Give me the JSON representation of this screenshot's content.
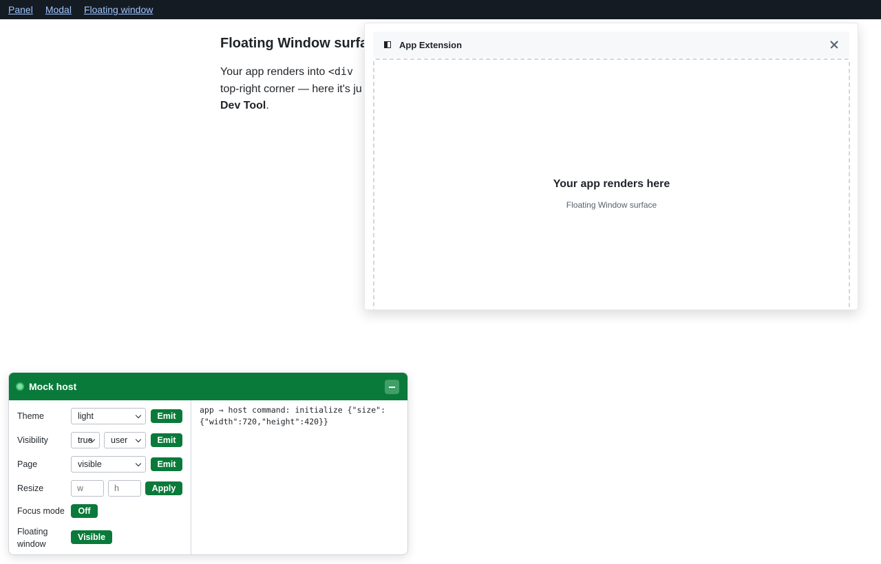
{
  "nav": {
    "links": [
      "Panel",
      "Modal",
      "Floating window"
    ]
  },
  "content": {
    "heading": "Floating Window surfa",
    "para_line1_pre": "Your app renders into ",
    "para_line1_code": "<div",
    "para_line2": "top-right corner — here it's ju",
    "para_line3_bold": "Dev Tool",
    "para_line3_tail": "."
  },
  "floating_window": {
    "title": "App Extension",
    "surface_title": "Your app renders here",
    "surface_subtitle": "Floating Window surface"
  },
  "mock_host": {
    "title": "Mock host",
    "theme": {
      "label": "Theme",
      "value": "light",
      "button": "Emit"
    },
    "visibility": {
      "label": "Visibility",
      "value1": "true",
      "value2": "user",
      "button": "Emit"
    },
    "page": {
      "label": "Page",
      "value": "visible",
      "button": "Emit"
    },
    "resize": {
      "label": "Resize",
      "w_placeholder": "w",
      "h_placeholder": "h",
      "button": "Apply"
    },
    "focus": {
      "label": "Focus mode",
      "button": "Off"
    },
    "floating": {
      "label_line1": "Floating",
      "label_line2": "window",
      "button": "Visible"
    },
    "log": "app → host command: initialize {\"size\":\n{\"width\":720,\"height\":420}}"
  },
  "colors": {
    "accent_green": "#0a7a3a",
    "nav_bg": "#151b23",
    "nav_link": "#9ec5ff"
  }
}
